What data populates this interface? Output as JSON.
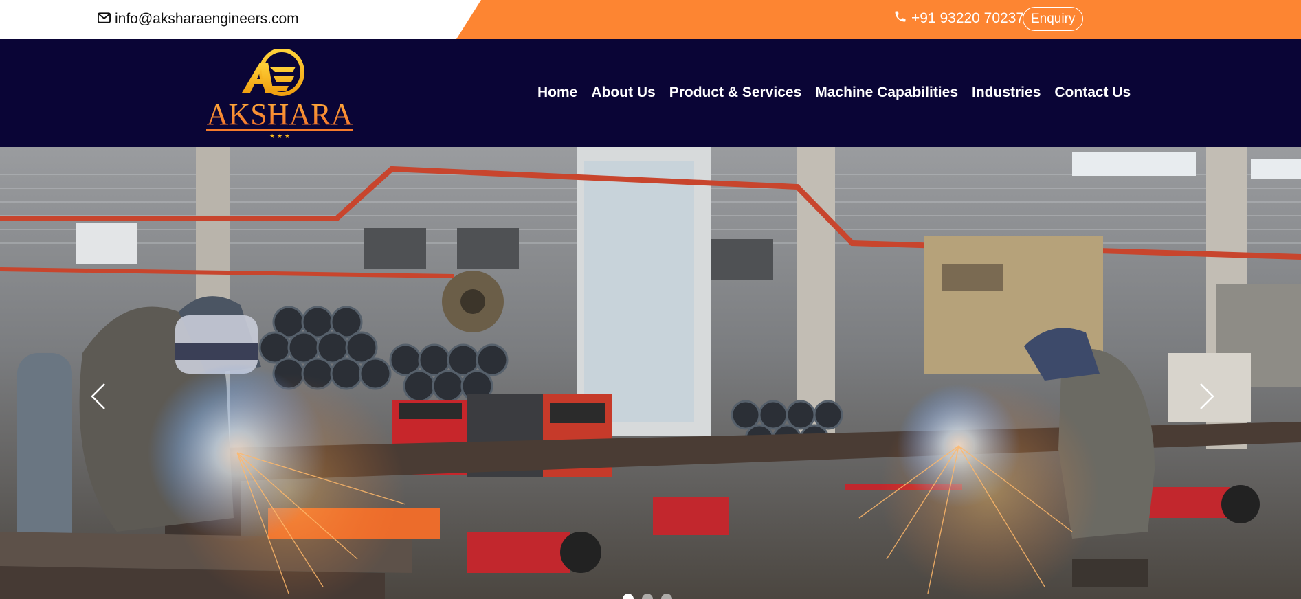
{
  "topbar": {
    "email": "info@aksharaengineers.com",
    "phone": "+91 93220 70237",
    "enquiry_label": "Enquiry"
  },
  "brand": {
    "name": "AKSHARA",
    "monogram": "AE",
    "logo_colors": {
      "gold": "#f5b71a",
      "orange": "#f37a2c"
    }
  },
  "nav": {
    "items": [
      {
        "label": "Home"
      },
      {
        "label": "About Us"
      },
      {
        "label": "Product & Services"
      },
      {
        "label": "Machine Capabilities"
      },
      {
        "label": "Industries"
      },
      {
        "label": "Contact Us"
      }
    ]
  },
  "hero": {
    "image_alt": "Welders working in an industrial fabrication workshop",
    "slide_count": 3,
    "active_slide": 1
  },
  "colors": {
    "accent_orange": "#fd8532",
    "header_navy": "#0a0536",
    "white": "#ffffff"
  },
  "icons": {
    "email": "envelope-icon",
    "phone": "phone-icon",
    "prev": "chevron-left-icon",
    "next": "chevron-right-icon"
  }
}
